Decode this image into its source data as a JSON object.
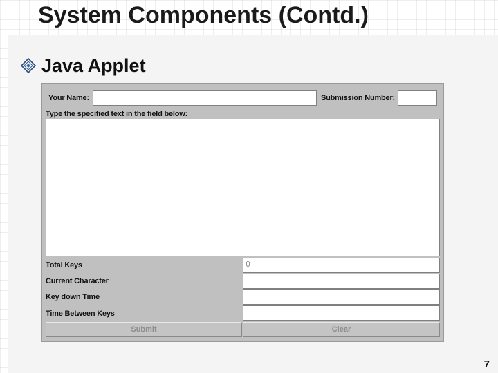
{
  "slide": {
    "title": "System Components (Contd.)",
    "bullet": "Java Applet",
    "page_number": "7"
  },
  "applet": {
    "your_name_label": "Your Name:",
    "your_name_value": "",
    "submission_number_label": "Submission Number:",
    "submission_number_value": "",
    "instruction": "Type the specified text in the field below:",
    "typing_area_value": "",
    "stats": [
      {
        "label": "Total Keys",
        "value": "0"
      },
      {
        "label": "Current Character",
        "value": ""
      },
      {
        "label": "Key down Time",
        "value": ""
      },
      {
        "label": "Time Between Keys",
        "value": ""
      }
    ],
    "submit_label": "Submit",
    "clear_label": "Clear"
  }
}
